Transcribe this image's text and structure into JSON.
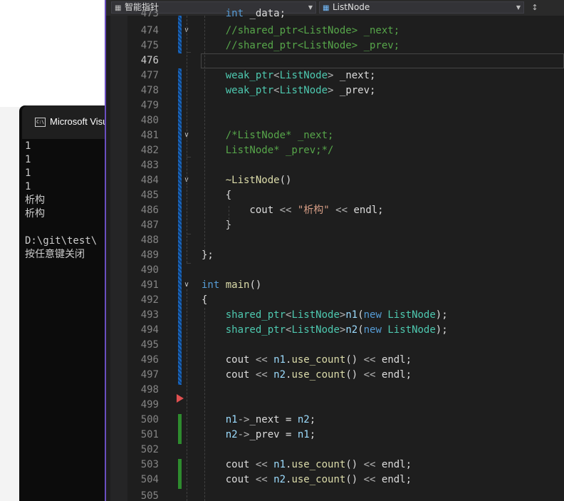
{
  "console": {
    "title": "Microsoft Visu",
    "output_lines": [
      "1",
      "1",
      "1",
      "1",
      "析构",
      "析构",
      "",
      "D:\\git\\test\\",
      "按任意键关闭"
    ]
  },
  "nav": {
    "scope_combo": "智能指针",
    "member_combo": "ListNode"
  },
  "colors": {
    "comment": "#57a64a",
    "type": "#4ec9b0",
    "keyword": "#569cd6",
    "function": "#dcdcaa",
    "string": "#d69d85",
    "variable": "#9cdcfe",
    "change_saved": "#1a67c0",
    "change_unsaved": "#2e8b2e",
    "accent": "#6a4ec0"
  },
  "active_line": "476",
  "lines": [
    {
      "n": "474",
      "fold": true,
      "tokens": [
        [
          "cmt",
          "    //shared_ptr<ListNode> _next;"
        ]
      ]
    },
    {
      "n": "475",
      "tokens": [
        [
          "cmt",
          "    //shared_ptr<ListNode> _prev;"
        ]
      ]
    },
    {
      "n": "476",
      "tokens": []
    },
    {
      "n": "477",
      "tokens": [
        [
          "plain",
          "    "
        ],
        [
          "typ",
          "weak_ptr"
        ],
        [
          "op",
          "<"
        ],
        [
          "typ",
          "ListNode"
        ],
        [
          "op",
          ">"
        ],
        [
          "plain",
          " _next;"
        ]
      ]
    },
    {
      "n": "478",
      "tokens": [
        [
          "plain",
          "    "
        ],
        [
          "typ",
          "weak_ptr"
        ],
        [
          "op",
          "<"
        ],
        [
          "typ",
          "ListNode"
        ],
        [
          "op",
          ">"
        ],
        [
          "plain",
          " _prev;"
        ]
      ]
    },
    {
      "n": "479",
      "tokens": []
    },
    {
      "n": "480",
      "tokens": []
    },
    {
      "n": "481",
      "fold": true,
      "tokens": [
        [
          "cmt",
          "    /*ListNode* _next;"
        ]
      ]
    },
    {
      "n": "482",
      "tokens": [
        [
          "cmt",
          "    ListNode* _prev;*/"
        ]
      ]
    },
    {
      "n": "483",
      "tokens": []
    },
    {
      "n": "484",
      "fold": true,
      "tokens": [
        [
          "plain",
          "    "
        ],
        [
          "fn",
          "~ListNode"
        ],
        [
          "plain",
          "()"
        ]
      ]
    },
    {
      "n": "485",
      "tokens": [
        [
          "plain",
          "    {"
        ]
      ]
    },
    {
      "n": "486",
      "tokens": [
        [
          "plain",
          "        cout "
        ],
        [
          "op",
          "<<"
        ],
        [
          "plain",
          " "
        ],
        [
          "str",
          "\"析构\""
        ],
        [
          "plain",
          " "
        ],
        [
          "op",
          "<<"
        ],
        [
          "plain",
          " endl;"
        ]
      ]
    },
    {
      "n": "487",
      "tokens": [
        [
          "plain",
          "    }"
        ]
      ]
    },
    {
      "n": "488",
      "tokens": []
    },
    {
      "n": "489",
      "tokens": [
        [
          "plain",
          "};"
        ]
      ]
    },
    {
      "n": "490",
      "tokens": []
    },
    {
      "n": "491",
      "fold": true,
      "tokens": [
        [
          "kw",
          "int"
        ],
        [
          "plain",
          " "
        ],
        [
          "fn",
          "main"
        ],
        [
          "plain",
          "()"
        ]
      ]
    },
    {
      "n": "492",
      "tokens": [
        [
          "plain",
          "{"
        ]
      ]
    },
    {
      "n": "493",
      "tokens": [
        [
          "plain",
          "    "
        ],
        [
          "typ",
          "shared_ptr"
        ],
        [
          "op",
          "<"
        ],
        [
          "typ",
          "ListNode"
        ],
        [
          "op",
          ">"
        ],
        [
          "var",
          "n1"
        ],
        [
          "plain",
          "("
        ],
        [
          "kw",
          "new"
        ],
        [
          "plain",
          " "
        ],
        [
          "typ",
          "ListNode"
        ],
        [
          "plain",
          ");"
        ]
      ]
    },
    {
      "n": "494",
      "tokens": [
        [
          "plain",
          "    "
        ],
        [
          "typ",
          "shared_ptr"
        ],
        [
          "op",
          "<"
        ],
        [
          "typ",
          "ListNode"
        ],
        [
          "op",
          ">"
        ],
        [
          "var",
          "n2"
        ],
        [
          "plain",
          "("
        ],
        [
          "kw",
          "new"
        ],
        [
          "plain",
          " "
        ],
        [
          "typ",
          "ListNode"
        ],
        [
          "plain",
          ");"
        ]
      ]
    },
    {
      "n": "495",
      "tokens": []
    },
    {
      "n": "496",
      "tokens": [
        [
          "plain",
          "    cout "
        ],
        [
          "op",
          "<<"
        ],
        [
          "plain",
          " "
        ],
        [
          "var",
          "n1"
        ],
        [
          "plain",
          "."
        ],
        [
          "fn",
          "use_count"
        ],
        [
          "plain",
          "() "
        ],
        [
          "op",
          "<<"
        ],
        [
          "plain",
          " endl;"
        ]
      ]
    },
    {
      "n": "497",
      "tokens": [
        [
          "plain",
          "    cout "
        ],
        [
          "op",
          "<<"
        ],
        [
          "plain",
          " "
        ],
        [
          "var",
          "n2"
        ],
        [
          "plain",
          "."
        ],
        [
          "fn",
          "use_count"
        ],
        [
          "plain",
          "() "
        ],
        [
          "op",
          "<<"
        ],
        [
          "plain",
          " endl;"
        ]
      ]
    },
    {
      "n": "498",
      "tokens": []
    },
    {
      "n": "499",
      "tokens": []
    },
    {
      "n": "500",
      "tokens": [
        [
          "plain",
          "    "
        ],
        [
          "var",
          "n1"
        ],
        [
          "op",
          "->"
        ],
        [
          "plain",
          "_next = "
        ],
        [
          "var",
          "n2"
        ],
        [
          "plain",
          ";"
        ]
      ]
    },
    {
      "n": "501",
      "tokens": [
        [
          "plain",
          "    "
        ],
        [
          "var",
          "n2"
        ],
        [
          "op",
          "->"
        ],
        [
          "plain",
          "_prev = "
        ],
        [
          "var",
          "n1"
        ],
        [
          "plain",
          ";"
        ]
      ]
    },
    {
      "n": "502",
      "tokens": []
    },
    {
      "n": "503",
      "tokens": [
        [
          "plain",
          "    cout "
        ],
        [
          "op",
          "<<"
        ],
        [
          "plain",
          " "
        ],
        [
          "var",
          "n1"
        ],
        [
          "plain",
          "."
        ],
        [
          "fn",
          "use_count"
        ],
        [
          "plain",
          "() "
        ],
        [
          "op",
          "<<"
        ],
        [
          "plain",
          " endl;"
        ]
      ]
    },
    {
      "n": "504",
      "tokens": [
        [
          "plain",
          "    cout "
        ],
        [
          "op",
          "<<"
        ],
        [
          "plain",
          " "
        ],
        [
          "var",
          "n2"
        ],
        [
          "plain",
          "."
        ],
        [
          "fn",
          "use_count"
        ],
        [
          "plain",
          "() "
        ],
        [
          "op",
          "<<"
        ],
        [
          "plain",
          " endl;"
        ]
      ]
    }
  ]
}
